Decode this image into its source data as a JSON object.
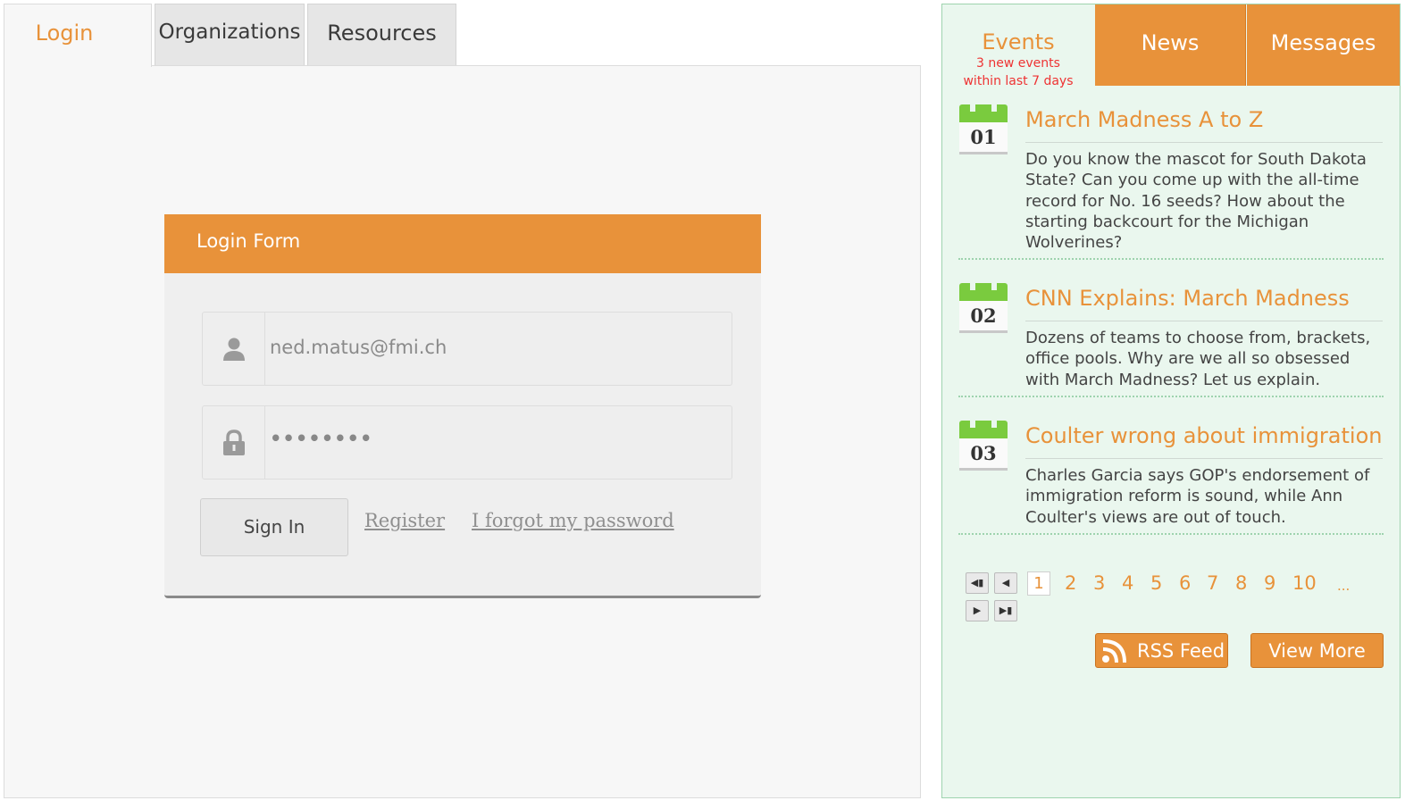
{
  "tabs": [
    {
      "label": "Login",
      "active": true
    },
    {
      "label": "Organizations",
      "active": false
    },
    {
      "label": "Resources",
      "active": false
    }
  ],
  "login_form": {
    "title": "Login Form",
    "email_value": "ned.matus@fmi.ch",
    "password_value": "••••••••",
    "signin_label": "Sign In",
    "register_label": "Register",
    "forgot_label": "I forgot my password"
  },
  "right_tabs": {
    "events_label": "Events",
    "events_sub_1": "3 new events",
    "events_sub_2": "within last 7 days",
    "news_label": "News",
    "messages_label": "Messages"
  },
  "events": [
    {
      "day": "01",
      "title": "March Madness A to Z",
      "desc_lines": [
        "Do you know the mascot for South Dakota",
        "State? Can you come up with the all-time",
        "record for No. 16 seeds? How about the",
        "starting backcourt for the Michigan",
        "Wolverines?"
      ]
    },
    {
      "day": "02",
      "title": "CNN Explains: March Madness",
      "desc_lines": [
        "Dozens of teams to choose from, brackets,",
        "office pools. Why are we all so obsessed",
        "with March Madness? Let us explain."
      ]
    },
    {
      "day": "03",
      "title": "Coulter wrong about immigration",
      "desc_lines": [
        "Charles Garcia says GOP's endorsement of",
        "immigration reform is sound, while Ann",
        "Coulter's views are out of touch."
      ]
    }
  ],
  "pagination": {
    "current": "1",
    "pages": [
      "2",
      "3",
      "4",
      "5",
      "6",
      "7",
      "8",
      "9",
      "10"
    ],
    "ellipsis": "..."
  },
  "buttons": {
    "rss_label": "RSS Feed",
    "view_more_label": "View More"
  },
  "colors": {
    "accent_orange": "#e8923a",
    "panel_green": "#eaf7ee",
    "calendar_green": "#7acb3e",
    "alert_red": "#e33333"
  },
  "icons": [
    "user-icon",
    "lock-icon",
    "calendar-icon",
    "rss-icon",
    "first-page-icon",
    "prev-page-icon",
    "next-page-icon",
    "last-page-icon"
  ]
}
